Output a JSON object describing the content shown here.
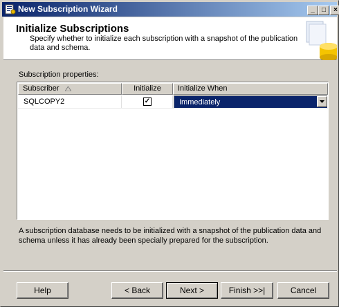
{
  "window": {
    "title": "New Subscription Wizard"
  },
  "header": {
    "title": "Initialize Subscriptions",
    "description": "Specify whether to initialize each subscription with a snapshot of the publication data and schema."
  },
  "properties": {
    "label": "Subscription properties:",
    "columns": {
      "subscriber": "Subscriber",
      "initialize": "Initialize",
      "initialize_when": "Initialize When"
    },
    "rows": [
      {
        "subscriber": "SQLCOPY2",
        "initialize": true,
        "initialize_when": "Immediately"
      }
    ]
  },
  "note": "A subscription database needs to be initialized with a snapshot of the publication data and schema unless it has already been specially prepared for the subscription.",
  "buttons": {
    "help": "Help",
    "back": "< Back",
    "next": "Next >",
    "finish": "Finish >>|",
    "cancel": "Cancel"
  },
  "colors": {
    "titlebar_start": "#0a246a",
    "titlebar_end": "#a6caf0",
    "selection": "#0a246a",
    "face": "#d4d0c8"
  }
}
